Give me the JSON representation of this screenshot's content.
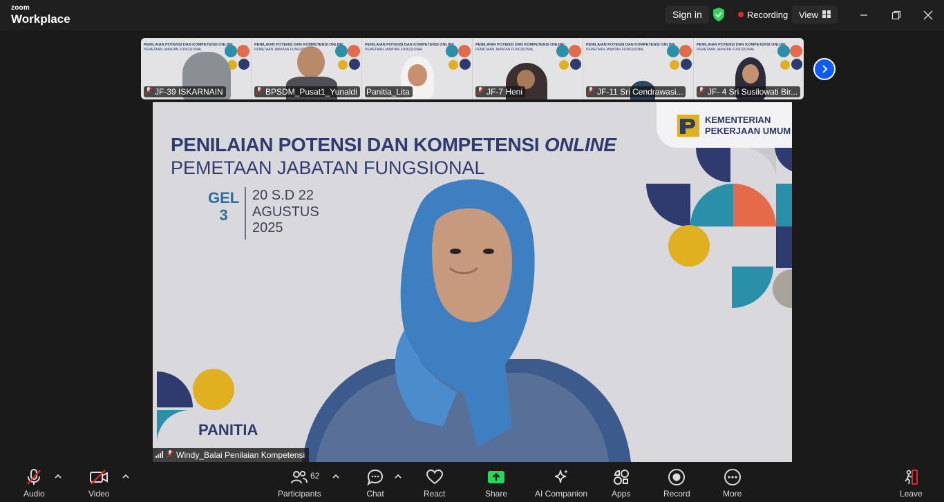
{
  "window": {
    "brand_small": "zoom",
    "brand_big": "Workplace",
    "sign_in": "Sign in",
    "recording": "Recording",
    "view": "View"
  },
  "thumbnails": [
    {
      "name": "JF-39 ISKARNAIN"
    },
    {
      "name": "BPSDM_Pusat1_Yunaldi"
    },
    {
      "name": "Panitia_Lita"
    },
    {
      "name": "JF-7 Heni"
    },
    {
      "name": "JF-11 Sri Cendrawasi..."
    },
    {
      "name": "JF- 4 Sri Susilowati Bir..."
    }
  ],
  "slide": {
    "logo_line1": "KEMENTERIAN",
    "logo_line2": "PEKERJAAN UMUM",
    "title_main": "PENILAIAN POTENSI DAN KOMPETENSI ",
    "title_online": "ONLINE",
    "subtitle": "PEMETAAN JABATAN FUNGSIONAL",
    "gel": "GEL",
    "gel_num": "3",
    "date_line1": "20 S.D 22",
    "date_line2": "AGUSTUS",
    "date_line3": "2025",
    "panitia": "PANITIA",
    "thumb_title": "PENILAIAN POTENSI DAN KOMPETENSI ONLINE",
    "thumb_subtitle": "PEMETAAN JABATAN FUNGSIONAL"
  },
  "main_speaker": {
    "name": "Windy_Balai Penilaian Kompetensi"
  },
  "toolbar": {
    "audio": "Audio",
    "video": "Video",
    "participants": "Participants",
    "participants_count": "62",
    "chat": "Chat",
    "react": "React",
    "share": "Share",
    "ai_companion": "AI Companion",
    "apps": "Apps",
    "record": "Record",
    "more": "More",
    "leave": "Leave"
  },
  "colors": {
    "accent_blue": "#0b5cff",
    "share_green": "#23d959",
    "muted_red": "#e02828",
    "slide_navy": "#2f3a6e",
    "slide_teal": "#2a8fa8",
    "slide_yellow": "#e0b020",
    "slide_orange": "#e56a4a"
  }
}
